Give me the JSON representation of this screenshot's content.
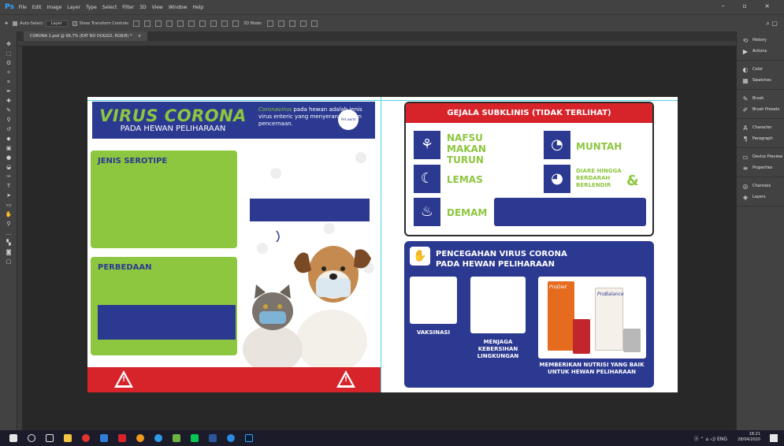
{
  "app": {
    "logo": "Ps",
    "menu": [
      "File",
      "Edit",
      "Image",
      "Layer",
      "Type",
      "Select",
      "Filter",
      "3D",
      "View",
      "Window",
      "Help"
    ],
    "window_controls": "– ▫ ×"
  },
  "options_bar": {
    "auto_select_label": "Auto-Select:",
    "auto_select_value": "Layer",
    "show_transform_label": "Show Transform Controls",
    "mode_3d_label": "3D Mode:"
  },
  "document": {
    "tab_title": "CORONA 1.psd @ 66,7% (EAT NO DOGGO, RGB/8) *",
    "tab_close": "×"
  },
  "right_panel": {
    "groups": [
      [
        {
          "icon": "history-icon",
          "glyph": "⟲",
          "label": "History"
        },
        {
          "icon": "actions-icon",
          "glyph": "▶",
          "label": "Actions"
        }
      ],
      [
        {
          "icon": "color-icon",
          "glyph": "◐",
          "label": "Color"
        },
        {
          "icon": "swatches-icon",
          "glyph": "▦",
          "label": "Swatches"
        }
      ],
      [
        {
          "icon": "brush-icon",
          "glyph": "✎",
          "label": "Brush"
        },
        {
          "icon": "brush-presets-icon",
          "glyph": "✐",
          "label": "Brush Presets"
        }
      ],
      [
        {
          "icon": "character-icon",
          "glyph": "A",
          "label": "Character"
        },
        {
          "icon": "paragraph-icon",
          "glyph": "¶",
          "label": "Paragraph"
        }
      ],
      [
        {
          "icon": "device-preview-icon",
          "glyph": "▭",
          "label": "Device Preview"
        },
        {
          "icon": "properties-icon",
          "glyph": "≡",
          "label": "Properties"
        }
      ],
      [
        {
          "icon": "channels-icon",
          "glyph": "◎",
          "label": "Channels"
        },
        {
          "icon": "layers-icon",
          "glyph": "◈",
          "label": "Layers"
        }
      ]
    ]
  },
  "poster_left": {
    "title": "VIRUS CORONA",
    "subtitle": "PADA HEWAN PELIHARAAN",
    "desc_highlight": "Coronavirus",
    "desc_rest": " pada hewan adalah jenis virus enteric yang menyerang sistem pencernaan.",
    "logo_text": "Pet world",
    "serotipe_label": "JENIS SEROTIPE",
    "perbedaan_label": "PERBEDAAN",
    "warning_glyph": "!"
  },
  "poster_right": {
    "gejala_title": "GEJALA SUBKLINIS (TIDAK TERLIHAT)",
    "symptoms": {
      "nafsu": "NAFSU MAKAN TURUN",
      "muntah": "MUNTAH",
      "lemas": "LEMAS",
      "diare": "DIARE HINGGA BERDARAH BERLENDIR",
      "diare_amp": "&",
      "demam": "DEMAM"
    },
    "pencegahan_title": "PENCEGAHAN VIRUS CORONA PADA HEWAN PELIHARAAN",
    "vaksinasi": "VAKSINASI",
    "kebersihan": "MENJAGA KEBERSIHAN LINGKUNGAN",
    "nutrisi": "MEMBERIKAN NUTRISI YANG BAIK UNTUK HEWAN PELIHARAAN",
    "brand1": "ProDiet",
    "brand2": "ProBalance"
  },
  "taskbar": {
    "time": "18:21",
    "date": "28/04/2020",
    "lang": "ENG"
  },
  "colors": {
    "navy": "#2b3990",
    "green": "#8dc63f",
    "red": "#d7242a"
  }
}
